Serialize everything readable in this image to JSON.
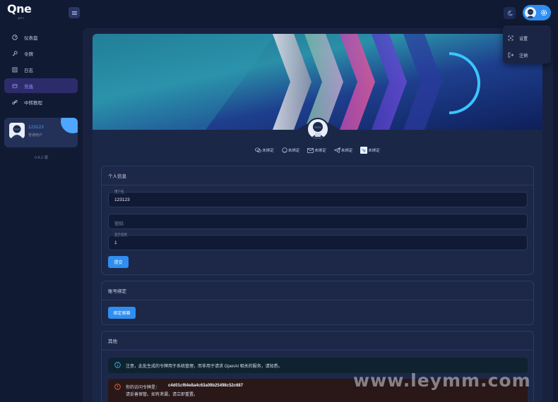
{
  "app": {
    "logo_text": "Qne",
    "logo_sub": "API"
  },
  "dropdown": {
    "items": [
      {
        "label": "设置",
        "icon": "settings-icon"
      },
      {
        "label": "注销",
        "icon": "logout-icon"
      }
    ]
  },
  "sidebar": {
    "items": [
      {
        "label": "仪表盘",
        "icon": "dashboard-icon",
        "active": false
      },
      {
        "label": "令牌",
        "icon": "key-icon",
        "active": false
      },
      {
        "label": "日志",
        "icon": "log-icon",
        "active": false
      },
      {
        "label": "充值",
        "icon": "wallet-icon",
        "active": true
      },
      {
        "label": "中转教程",
        "icon": "link-icon",
        "active": false
      }
    ],
    "user": {
      "name": "123123",
      "role": "普通用户"
    },
    "version": "0.8.2 版"
  },
  "bindings": [
    {
      "label": "未绑定",
      "icon": "wechat-icon"
    },
    {
      "label": "未绑定",
      "icon": "github-icon"
    },
    {
      "label": "未绑定",
      "icon": "email-icon"
    },
    {
      "label": "未绑定",
      "icon": "telegram-icon"
    },
    {
      "label": "未绑定",
      "icon": "lark-icon"
    }
  ],
  "personal_info": {
    "title": "个人信息",
    "username": {
      "label": "用户名",
      "value": "123123"
    },
    "password": {
      "placeholder": "密码"
    },
    "display_name": {
      "label": "显示名称",
      "value": "1"
    },
    "submit_label": "提交"
  },
  "account_binding": {
    "title": "账号绑定",
    "bind_email_label": "绑定邮箱"
  },
  "other": {
    "title": "其他",
    "info_text": "注意，此处生成的令牌用于系统管理，而非用于请求 OpenAI 相关的服务，请知悉。",
    "token_label": "你的访问令牌是：",
    "token_value": "c4d01cf64e8a4c63a09b25498c52c687",
    "token_hint": "请妥善保管。如有泄漏，请立即重置。"
  },
  "colors": {
    "accent": "#2f8ef0",
    "active_nav_text": "#9e8cff",
    "background": "#111a33"
  },
  "watermark": "www.leymm.com"
}
